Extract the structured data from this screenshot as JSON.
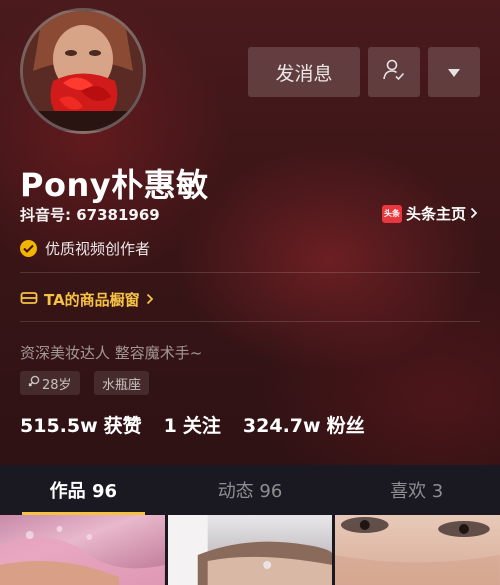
{
  "header": {
    "message_button": "发消息",
    "follow_icon": "add-user-icon",
    "more_icon": "triangle-down-icon"
  },
  "profile": {
    "name": "Pony朴惠敏",
    "douyin_id": "抖音号: 67381969",
    "toutiao_logo": "头条",
    "toutiao_link": "头条主页",
    "creator_badge": "优质视频创作者",
    "shop_link": "TA的商品橱窗",
    "bio": "资深美妆达人 整容魔术手~",
    "tags": {
      "age": "28岁",
      "sign": "水瓶座"
    },
    "stats": {
      "likes_num": "515.5w",
      "likes_label": "获赞",
      "following_num": "1",
      "following_label": "关注",
      "fans_num": "324.7w",
      "fans_label": "粉丝"
    }
  },
  "tabs": {
    "works": "作品 96",
    "dynamics": "动态 96",
    "likes": "喜欢 3"
  },
  "colors": {
    "accent": "#f6c244",
    "badge": "#f5b400",
    "toutiao": "#e8383d",
    "tabbar": "#1a1820"
  }
}
